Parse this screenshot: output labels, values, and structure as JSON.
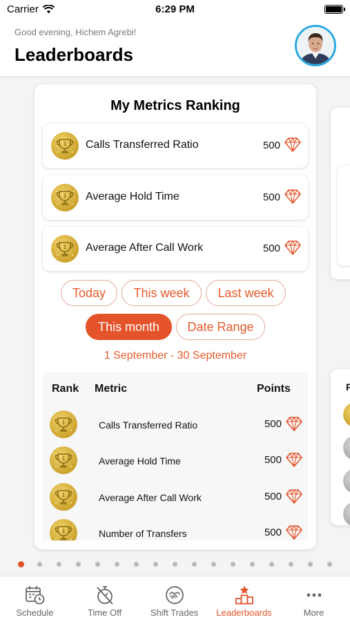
{
  "status_bar": {
    "carrier": "Carrier",
    "time": "6:29 PM"
  },
  "header": {
    "greeting": "Good evening, Hichem Agrebi!",
    "title": "Leaderboards",
    "avatar_icon": "user-avatar"
  },
  "card": {
    "title": "My Metrics Ranking",
    "metrics": [
      {
        "name": "Calls Transferred Ratio",
        "points": "500"
      },
      {
        "name": "Average Hold Time",
        "points": "500"
      },
      {
        "name": "Average After Call Work",
        "points": "500"
      }
    ],
    "filters": [
      {
        "label": "Today",
        "active": false
      },
      {
        "label": "This week",
        "active": false
      },
      {
        "label": "Last week",
        "active": false
      },
      {
        "label": "This month",
        "active": true
      },
      {
        "label": "Date Range",
        "active": false
      }
    ],
    "date_range": "1 September - 30 September",
    "table": {
      "headers": {
        "rank": "Rank",
        "metric": "Metric",
        "points": "Points"
      },
      "rows": [
        {
          "metric": "Calls Transferred Ratio",
          "points": "500"
        },
        {
          "metric": "Average Hold Time",
          "points": "500"
        },
        {
          "metric": "Average After Call Work",
          "points": "500"
        },
        {
          "metric": "Number of Transfers",
          "points": "500"
        }
      ]
    }
  },
  "peek_table": {
    "rank_initial": "R"
  },
  "pager": {
    "count": 17,
    "active_index": 0
  },
  "tabbar": {
    "items": [
      {
        "label": "Schedule",
        "icon": "calendar-clock-icon",
        "active": false
      },
      {
        "label": "Time Off",
        "icon": "stopwatch-off-icon",
        "active": false
      },
      {
        "label": "Shift Trades",
        "icon": "handshake-icon",
        "active": false
      },
      {
        "label": "Leaderboards",
        "icon": "podium-star-icon",
        "active": true
      },
      {
        "label": "More",
        "icon": "more-dots-icon",
        "active": false
      }
    ]
  },
  "colors": {
    "accent": "#e4532a",
    "medal_gold": "#d9b437",
    "avatar_ring": "#29a9e1",
    "inactive_tab": "#666666"
  }
}
